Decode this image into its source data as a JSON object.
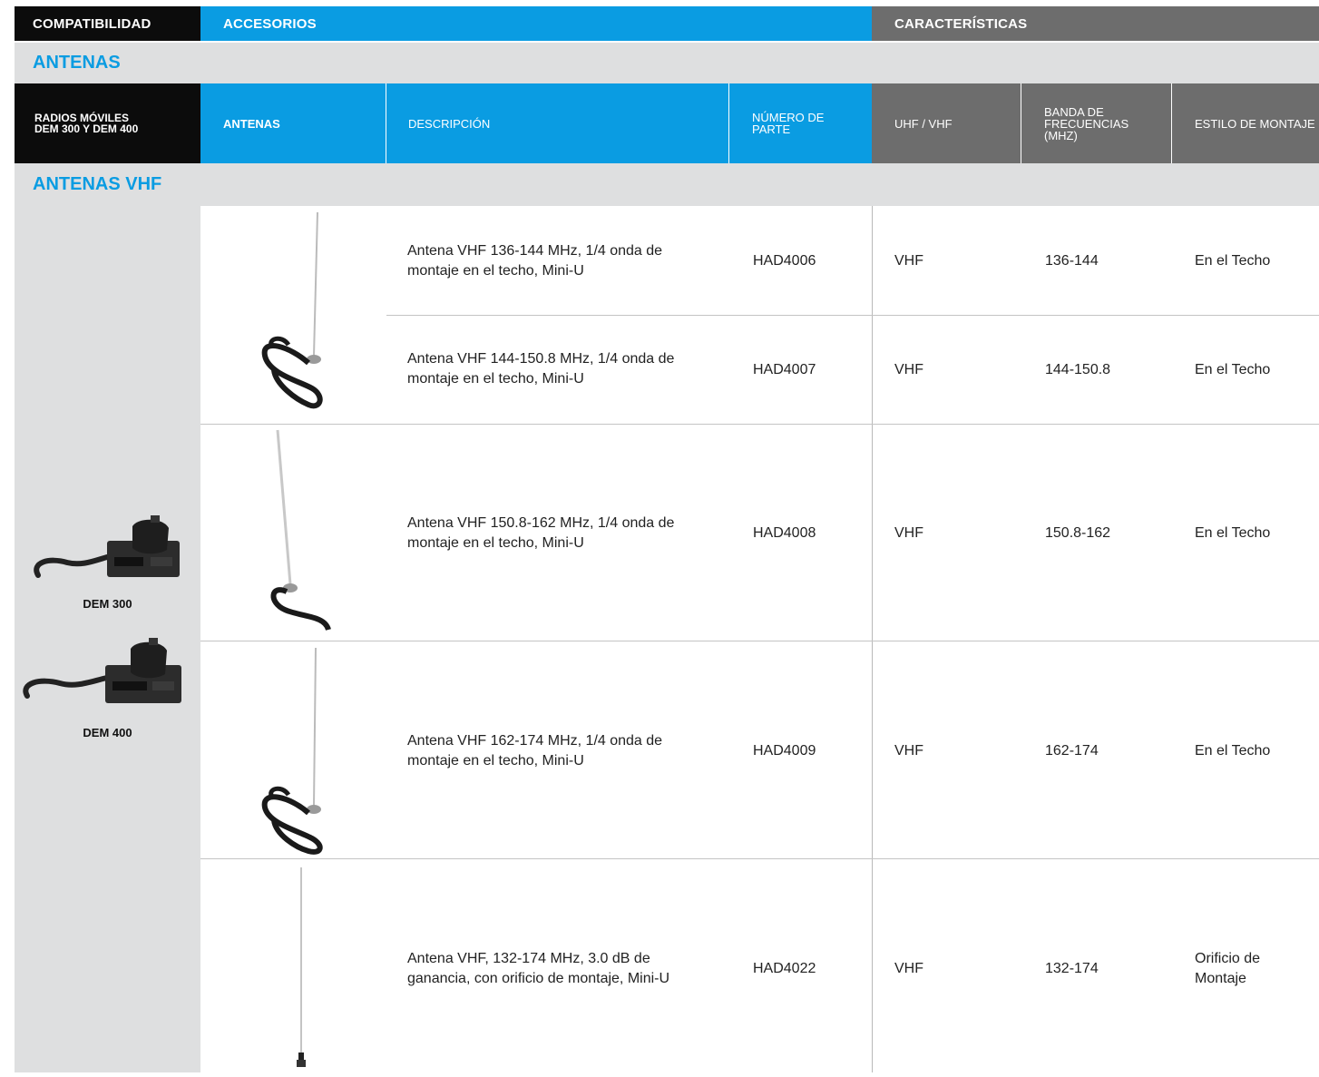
{
  "header": {
    "compat": "COMPATIBILIDAD",
    "accessories": "ACCESORIOS",
    "features": "CARACTERÍSTICAS"
  },
  "section_title": "ANTENAS",
  "columns": {
    "radios_line1": "RADIOS MÓVILES",
    "radios_line2": "DEM 300 Y DEM 400",
    "antennas": "ANTENAS",
    "description": "DESCRIPCIÓN",
    "part_number_line1": "NÚMERO DE",
    "part_number_line2": "PARTE",
    "band_type": "UHF / VHF",
    "freq_line1": "BANDA DE",
    "freq_line2": "FRECUENCIAS",
    "freq_line3": "(MHZ)",
    "mount_style": "ESTILO DE MONTAJE"
  },
  "subsection_title": "ANTENAS VHF",
  "radios": [
    {
      "name": "DEM 300"
    },
    {
      "name": "DEM 400"
    }
  ],
  "rows": [
    {
      "desc_line1": "Antena VHF 136-144 MHz, 1/4 onda de",
      "desc_line2": "montaje en el techo, Mini-U",
      "part": "HAD4006",
      "band": "VHF",
      "freq": "136-144",
      "mount_line1": "En el Techo",
      "mount_line2": ""
    },
    {
      "desc_line1": "Antena VHF 144-150.8 MHz, 1/4 onda de",
      "desc_line2": "montaje en el techo, Mini-U",
      "part": "HAD4007",
      "band": "VHF",
      "freq": "144-150.8",
      "mount_line1": "En el Techo",
      "mount_line2": ""
    },
    {
      "desc_line1": "Antena VHF 150.8-162 MHz, 1/4 onda de",
      "desc_line2": "montaje en el techo, Mini-U",
      "part": "HAD4008",
      "band": "VHF",
      "freq": "150.8-162",
      "mount_line1": "En el Techo",
      "mount_line2": ""
    },
    {
      "desc_line1": "Antena VHF 162-174 MHz, 1/4 onda de",
      "desc_line2": "montaje en el techo, Mini-U",
      "part": "HAD4009",
      "band": "VHF",
      "freq": "162-174",
      "mount_line1": "En el Techo",
      "mount_line2": ""
    },
    {
      "desc_line1": "Antena VHF, 132-174 MHz, 3.0 dB de",
      "desc_line2": "ganancia, con orificio de montaje, Mini-U",
      "part": "HAD4022",
      "band": "VHF",
      "freq": "132-174",
      "mount_line1": "Orificio de",
      "mount_line2": "Montaje"
    }
  ]
}
